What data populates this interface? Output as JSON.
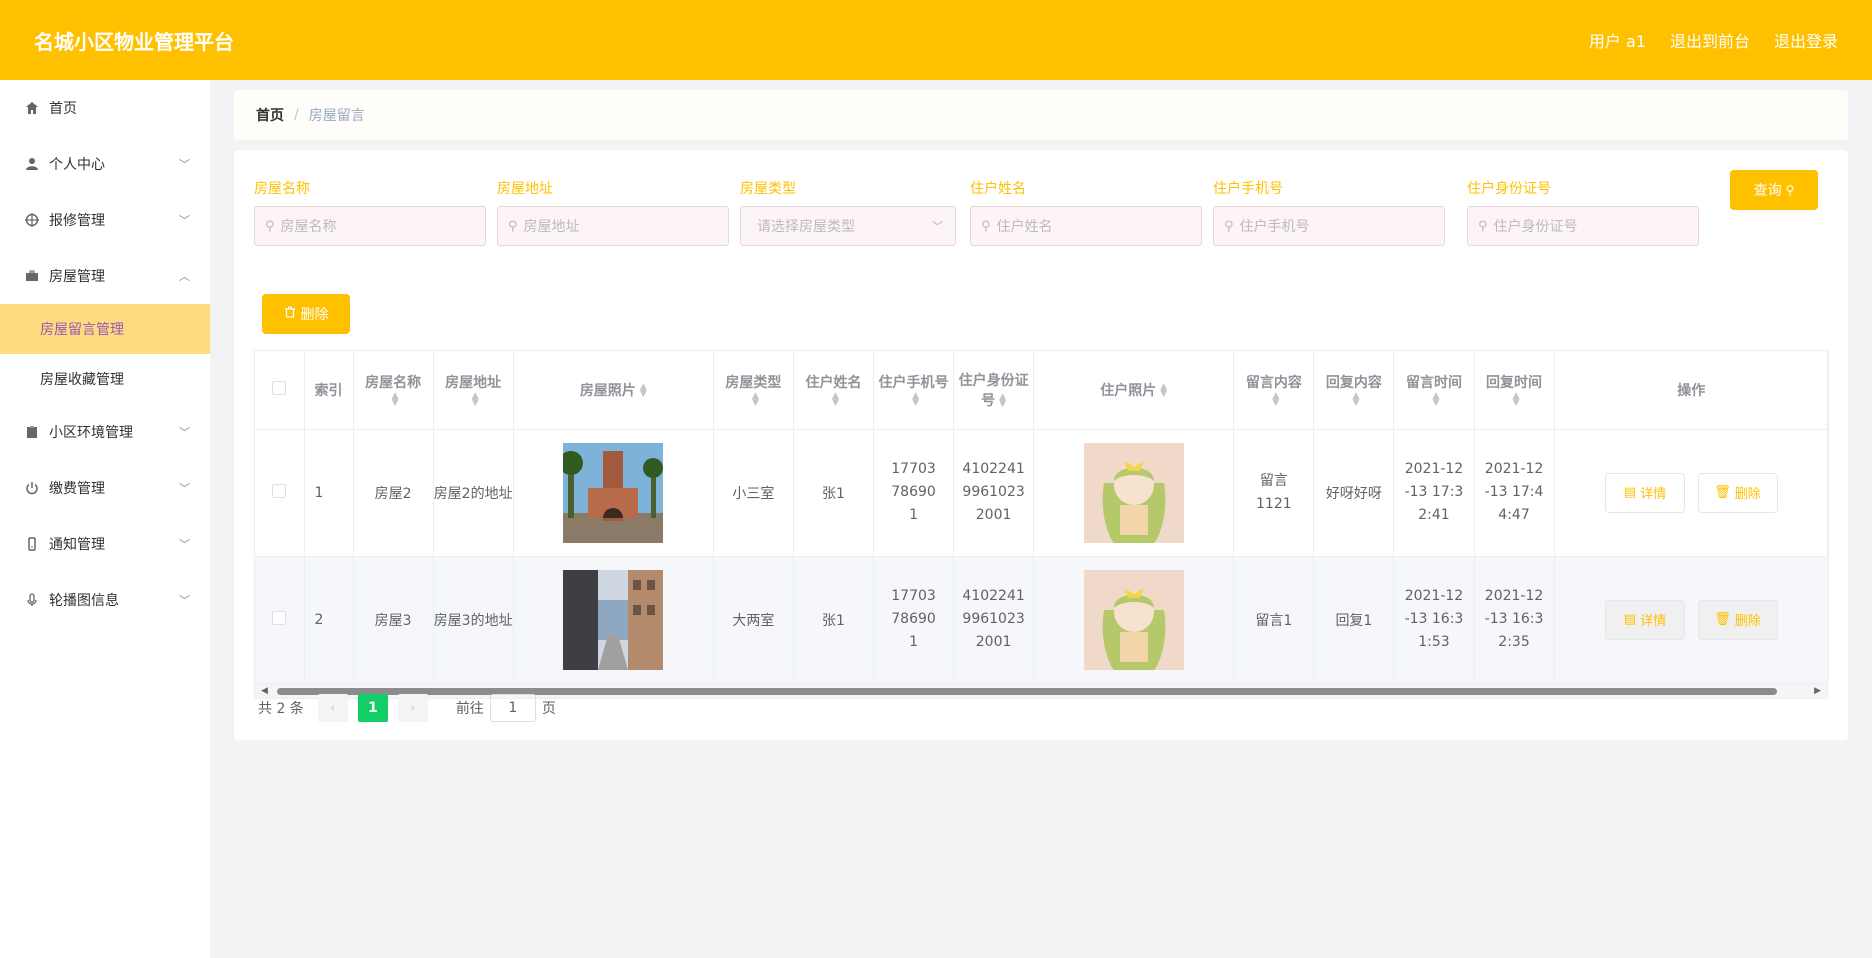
{
  "header": {
    "title": "名城小区物业管理平台",
    "links": [
      "用户 a1",
      "退出到前台",
      "退出登录"
    ]
  },
  "sidebar": {
    "items": [
      {
        "label": "首页",
        "icon": "home-icon"
      },
      {
        "label": "个人中心",
        "icon": "user-icon"
      },
      {
        "label": "报修管理",
        "icon": "crosshair-icon"
      },
      {
        "label": "房屋管理",
        "icon": "briefcase-icon",
        "expanded": true,
        "children": [
          "房屋留言管理",
          "房屋收藏管理"
        ]
      },
      {
        "label": "小区环境管理",
        "icon": "clipboard-icon"
      },
      {
        "label": "缴费管理",
        "icon": "power-icon"
      },
      {
        "label": "通知管理",
        "icon": "device-icon"
      },
      {
        "label": "轮播图信息",
        "icon": "mic-icon"
      }
    ],
    "active": "房屋留言管理"
  },
  "breadcrumb": {
    "home": "首页",
    "sep": "/",
    "current": "房屋留言"
  },
  "search": {
    "fields": [
      {
        "label": "房屋名称",
        "placeholder": "房屋名称"
      },
      {
        "label": "房屋地址",
        "placeholder": "房屋地址"
      },
      {
        "label": "房屋类型",
        "placeholder": "请选择房屋类型"
      },
      {
        "label": "住户姓名",
        "placeholder": "住户姓名"
      },
      {
        "label": "住户手机号",
        "placeholder": "住户手机号"
      },
      {
        "label": "住户身份证号",
        "placeholder": "住户身份证号"
      }
    ],
    "query_label": "查询",
    "delete_label": "删除"
  },
  "table": {
    "headers": [
      "索引",
      "房屋名称",
      "房屋地址",
      "房屋照片",
      "房屋类型",
      "住户姓名",
      "住户手机号",
      "住户身份证号",
      "住户照片",
      "留言内容",
      "回复内容",
      "留言时间",
      "回复时间",
      "操作"
    ],
    "rows": [
      {
        "index": "1",
        "name": "房屋2",
        "address": "房屋2的地址",
        "type": "小三室",
        "resident": "张1",
        "phone": "17703786901",
        "idcard": "410224199610232001",
        "message": "留言1121",
        "reply": "好呀好呀",
        "msg_time": "2021-12-13 17:32:41",
        "reply_time": "2021-12-13 17:44:47"
      },
      {
        "index": "2",
        "name": "房屋3",
        "address": "房屋3的地址",
        "type": "大两室",
        "resident": "张1",
        "phone": "17703786901",
        "idcard": "410224199610232001",
        "message": "留言1",
        "reply": "回复1",
        "msg_time": "2021-12-13 16:31:53",
        "reply_time": "2021-12-13 16:32:35"
      }
    ],
    "detail_label": "详情",
    "delete_label": "删除"
  },
  "pager": {
    "total": "共 2 条",
    "page": "1",
    "goto_prefix": "前往",
    "goto_value": "1",
    "goto_suffix": "页"
  },
  "colors": {
    "accent": "#ffc000",
    "active_bg": "#ffdb80",
    "page_green": "#13ce66"
  }
}
